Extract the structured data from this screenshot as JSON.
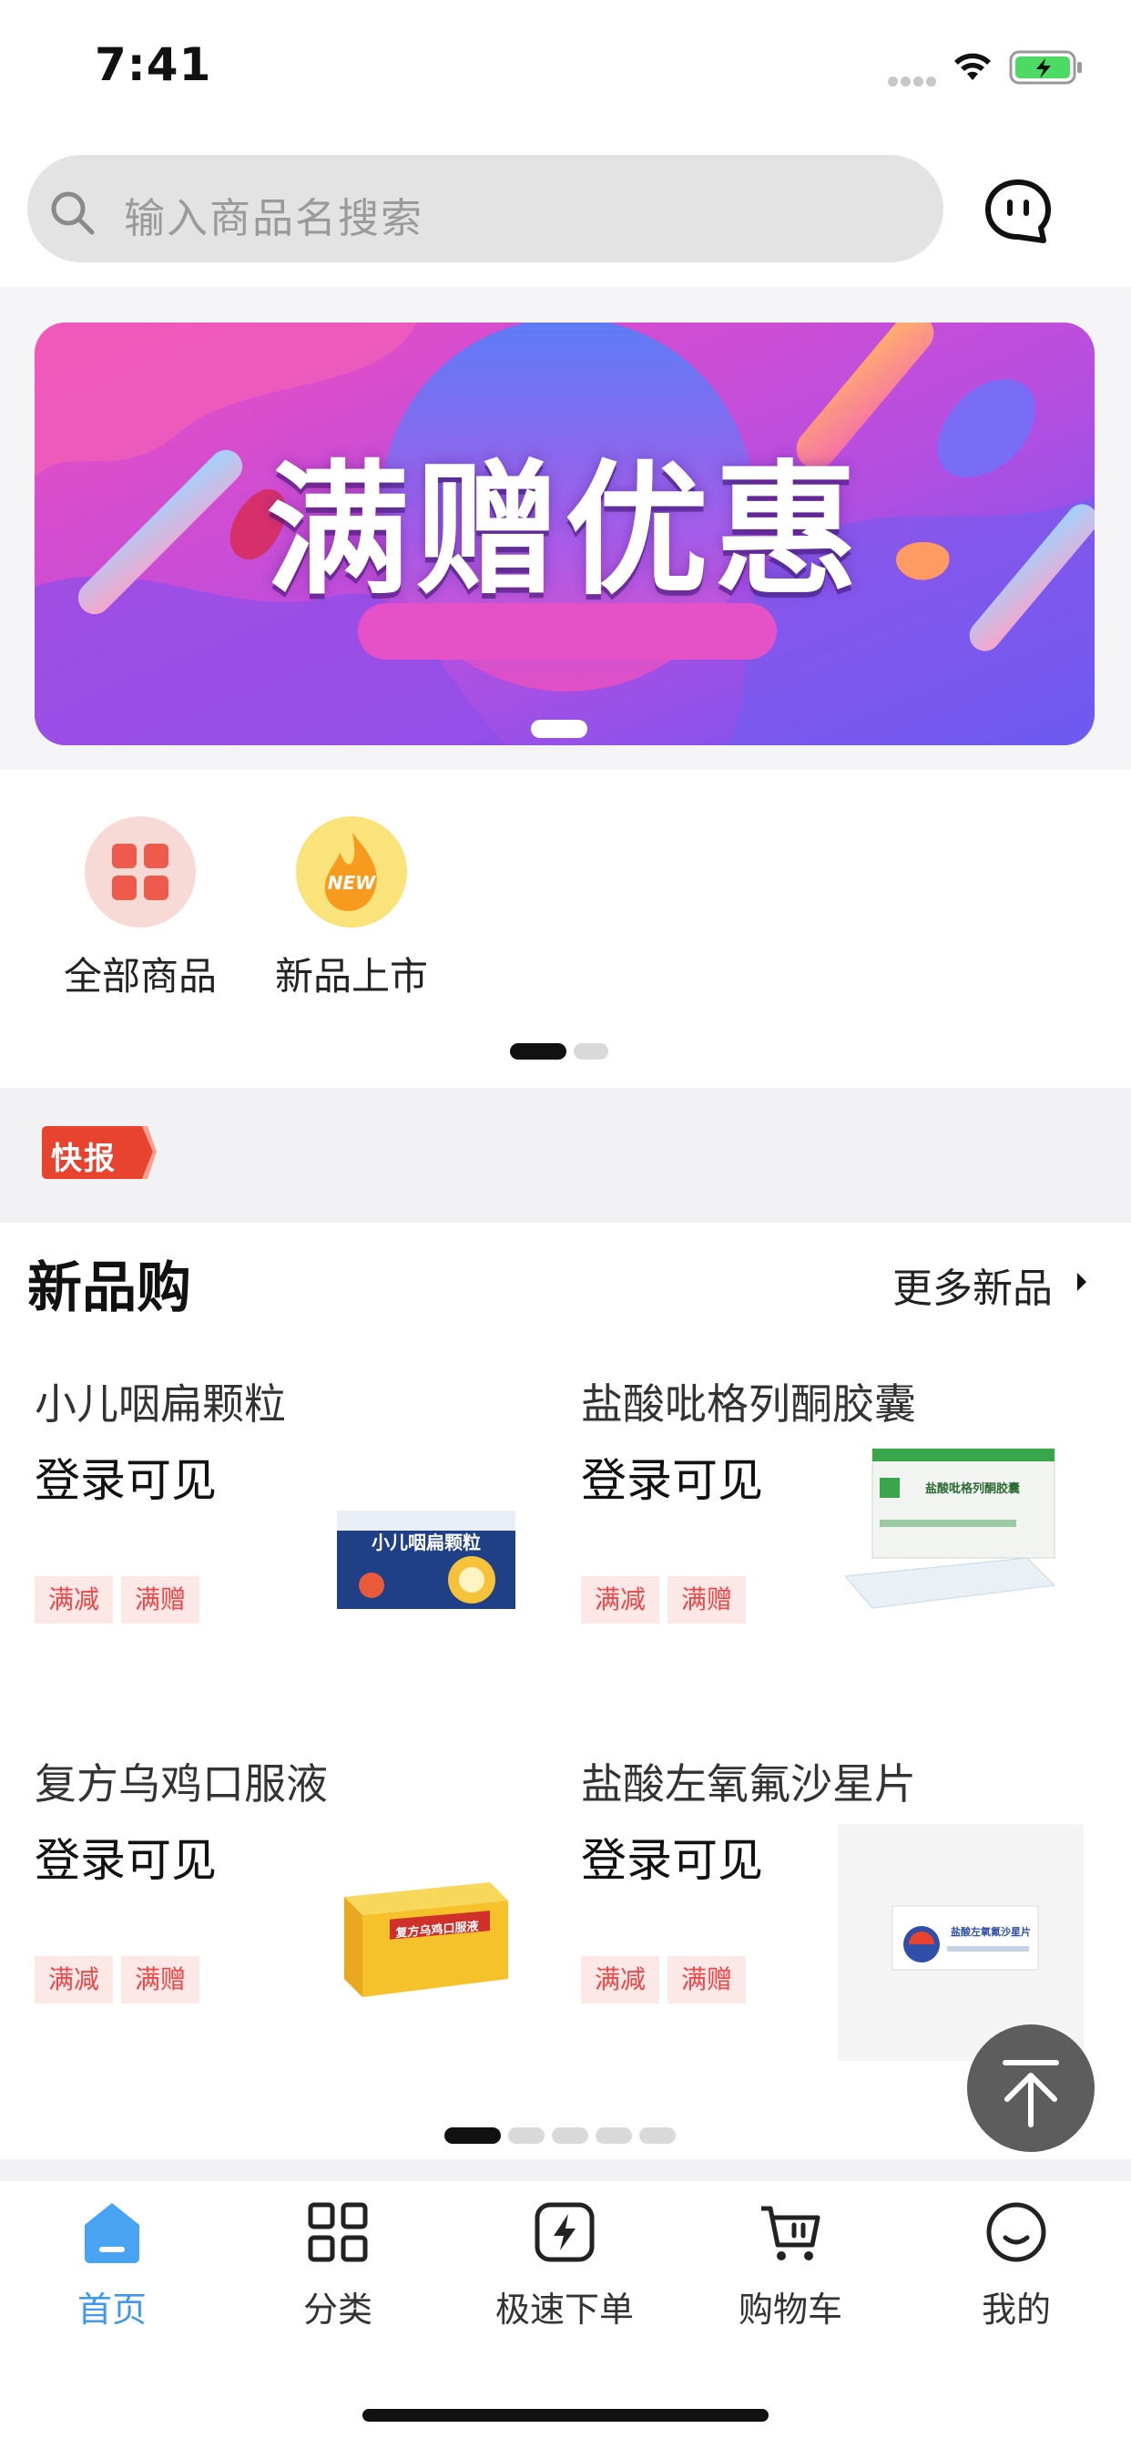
{
  "status_bar": {
    "time": "7:41"
  },
  "search": {
    "placeholder": "输入商品名搜索"
  },
  "banner": {
    "title": "满赠优惠"
  },
  "quick_entries": [
    {
      "label": "全部商品",
      "icon": "grid-icon"
    },
    {
      "label": "新品上市",
      "icon": "new-flame-icon",
      "badge": "NEW"
    }
  ],
  "news": {
    "badge": "快报"
  },
  "new_products": {
    "title": "新品购",
    "more_label": "更多新品",
    "items": [
      {
        "name": "小儿咽扁颗粒",
        "price": "登录可见",
        "tags": [
          "满减",
          "满赠"
        ],
        "box_text": "小儿咽扁颗粒"
      },
      {
        "name": "盐酸吡格列酮胶囊",
        "price": "登录可见",
        "tags": [
          "满减",
          "满赠"
        ],
        "box_text": "盐酸吡格列酮胶囊"
      },
      {
        "name": "复方乌鸡口服液",
        "price": "登录可见",
        "tags": [
          "满减",
          "满赠"
        ],
        "box_text": "复方乌鸡口服液"
      },
      {
        "name": "盐酸左氧氟沙星片",
        "price": "登录可见",
        "tags": [
          "满减",
          "满赠"
        ],
        "box_text": "盐酸左氧氟沙星片"
      }
    ]
  },
  "tabs": [
    {
      "label": "首页",
      "icon": "home-icon",
      "active": true
    },
    {
      "label": "分类",
      "icon": "category-grid-icon"
    },
    {
      "label": "极速下单",
      "icon": "lightning-icon"
    },
    {
      "label": "购物车",
      "icon": "cart-icon"
    },
    {
      "label": "我的",
      "icon": "profile-smile-icon"
    }
  ],
  "colors": {
    "accent": "#3f97ee",
    "tag_text": "#f04545",
    "tag_bg": "#fde8e8",
    "news_badge": "#e8432f"
  }
}
